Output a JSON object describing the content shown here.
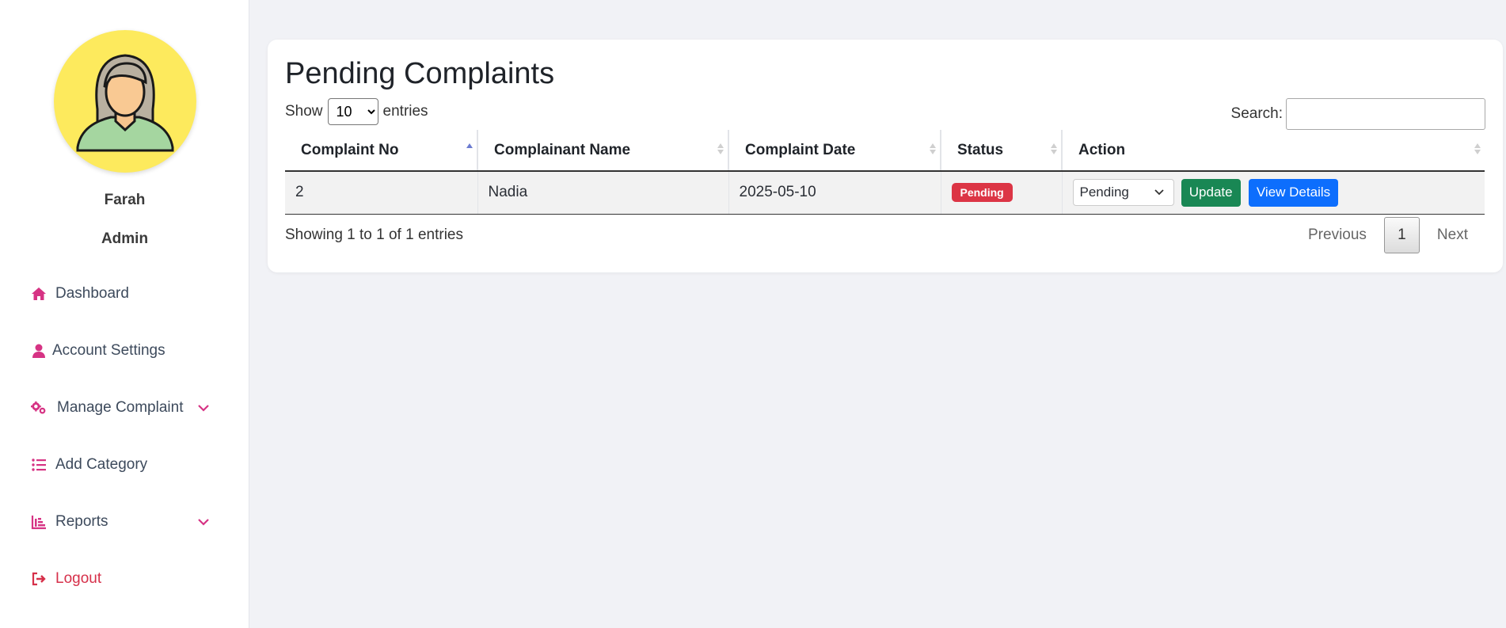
{
  "user": {
    "name": "Farah",
    "role": "Admin"
  },
  "nav": {
    "dashboard": "Dashboard",
    "account_settings": "Account Settings",
    "manage_complaint": "Manage Complaint",
    "add_category": "Add Category",
    "reports": "Reports",
    "logout": "Logout"
  },
  "page": {
    "title": "Pending Complaints"
  },
  "controls": {
    "show_label": "Show",
    "entries_value": "10",
    "entries_label": "entries",
    "search_label": "Search:",
    "search_value": ""
  },
  "table": {
    "headers": [
      "Complaint No",
      "Complainant Name",
      "Complaint Date",
      "Status",
      "Action"
    ],
    "rows": [
      {
        "complaint_no": "2",
        "complainant_name": "Nadia",
        "complaint_date": "2025-05-10",
        "status": "Pending",
        "action_select": "Pending",
        "update_label": "Update",
        "view_label": "View Details"
      }
    ]
  },
  "footer": {
    "info": "Showing 1 to 1 of 1 entries",
    "previous": "Previous",
    "current_page": "1",
    "next": "Next"
  },
  "colors": {
    "accent_icon": "#d63384",
    "badge_pending": "#dc3545",
    "update_button": "#198754",
    "view_button": "#0d6efd",
    "avatar_bg": "#fdea5d"
  }
}
